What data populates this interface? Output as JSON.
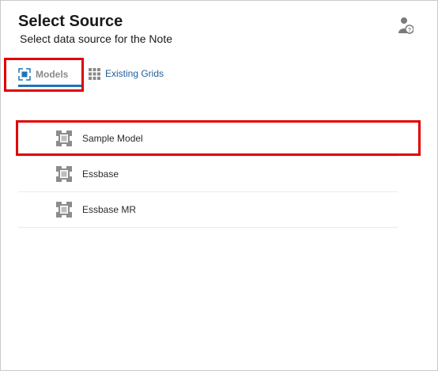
{
  "dialog": {
    "title": "Select Source",
    "subtitle": "Select data source for the Note",
    "help_icon": "user-help-icon"
  },
  "tabs": [
    {
      "label": "Models",
      "icon": "models-icon",
      "selected": true
    },
    {
      "label": "Existing Grids",
      "icon": "grid-icon",
      "selected": false
    }
  ],
  "sources": [
    {
      "label": "Sample Model",
      "icon": "model-cube-icon"
    },
    {
      "label": "Essbase",
      "icon": "model-cube-icon"
    },
    {
      "label": "Essbase MR",
      "icon": "model-cube-icon"
    }
  ],
  "colors": {
    "accent": "#1f74b8",
    "highlight": "#e00000",
    "link": "#1f5f99"
  }
}
